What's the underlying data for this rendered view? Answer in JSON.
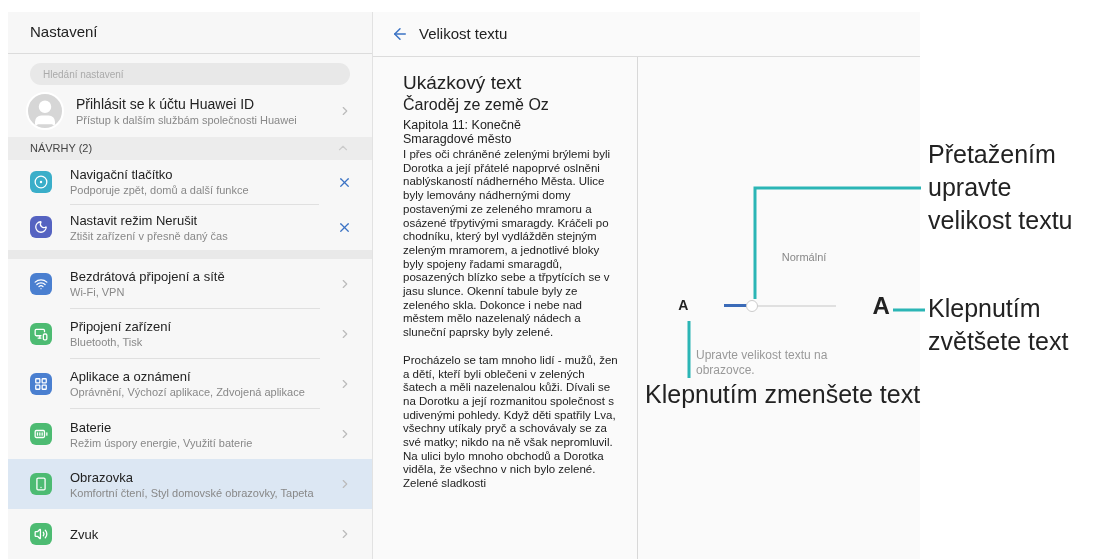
{
  "settings_panel": {
    "title": "Nastavení",
    "search": {
      "placeholder": "Hledání nastavení"
    },
    "account": {
      "title": "Přihlásit se k účtu Huawei ID",
      "subtitle": "Přístup k dalším službám společnosti Huawei"
    },
    "suggestions": {
      "header": "NÁVRHY (2)",
      "expanded": true,
      "items": [
        {
          "title": "Navigační tlačítko",
          "subtitle": "Podporuje zpět, domů a další funkce"
        },
        {
          "title": "Nastavit režim Nerušit",
          "subtitle": "Ztišit zařízení v přesně daný čas"
        }
      ]
    },
    "items": [
      {
        "title": "Bezdrátová připojení a sítě",
        "subtitle": "Wi-Fi, VPN",
        "selected": false
      },
      {
        "title": "Připojení zařízení",
        "subtitle": "Bluetooth, Tisk",
        "selected": false
      },
      {
        "title": "Aplikace a oznámení",
        "subtitle": "Oprávnění, Výchozí aplikace, Zdvojená aplikace",
        "selected": false
      },
      {
        "title": "Baterie",
        "subtitle": "Režim úspory energie, Využití baterie",
        "selected": false
      },
      {
        "title": "Obrazovka",
        "subtitle": "Komfortní čtení, Styl domovské obrazovky, Tapeta",
        "selected": true
      },
      {
        "title": "Zvuk",
        "selected": false
      }
    ]
  },
  "text_size_panel": {
    "title": "Velikost textu",
    "preview": {
      "heading": "Ukázkový text",
      "book_title": "Čaroděj ze země Oz",
      "chapter": "Kapitola 11: Konečně Smaragdové město",
      "paragraphs": [
        "I přes oči chráněné zelenými brýlemi byli Dorotka a její přátelé napoprvé oslněni nablýskaností nádherného Města. Ulice byly lemovány nádhernými domy postavenými ze zeleného mramoru a osázené třpytivými smaragdy. Kráčeli po chodníku, který byl vydlážděn stejným zeleným mramorem, a jednotlivé bloky byly spojeny řadami smaragdů, posazených blízko sebe a třpytících se v jasu slunce. Okenní tabule byly ze zeleného skla. Dokonce i nebe nad městem mělo nazelenalý nádech a sluneční paprsky byly zelené.",
        "Procházelo se tam mnoho lidí - mužů, žen a dětí, kteří byli oblečeni v zelených šatech a měli nazelenalou kůži. Dívali se na Dorotku a její rozmanitou společnost s udivenými pohledy. Když děti spatřily Lva, všechny utíkaly pryč a schovávaly se za své matky; nikdo na ně však nepromluvil. Na ulici bylo mnoho obchodů a Dorotka viděla, že všechno v nich bylo zelené. Zelené sladkosti"
      ]
    },
    "slider": {
      "value_label": "Normální",
      "small_label": "A",
      "large_label": "A",
      "level": 0.25
    },
    "description": "Upravte velikost textu na obrazovce."
  },
  "callouts": [
    "Přetažením upravte velikost textu",
    "Klepnutím zvětšete text",
    "Klepnutím zmenšete text"
  ]
}
